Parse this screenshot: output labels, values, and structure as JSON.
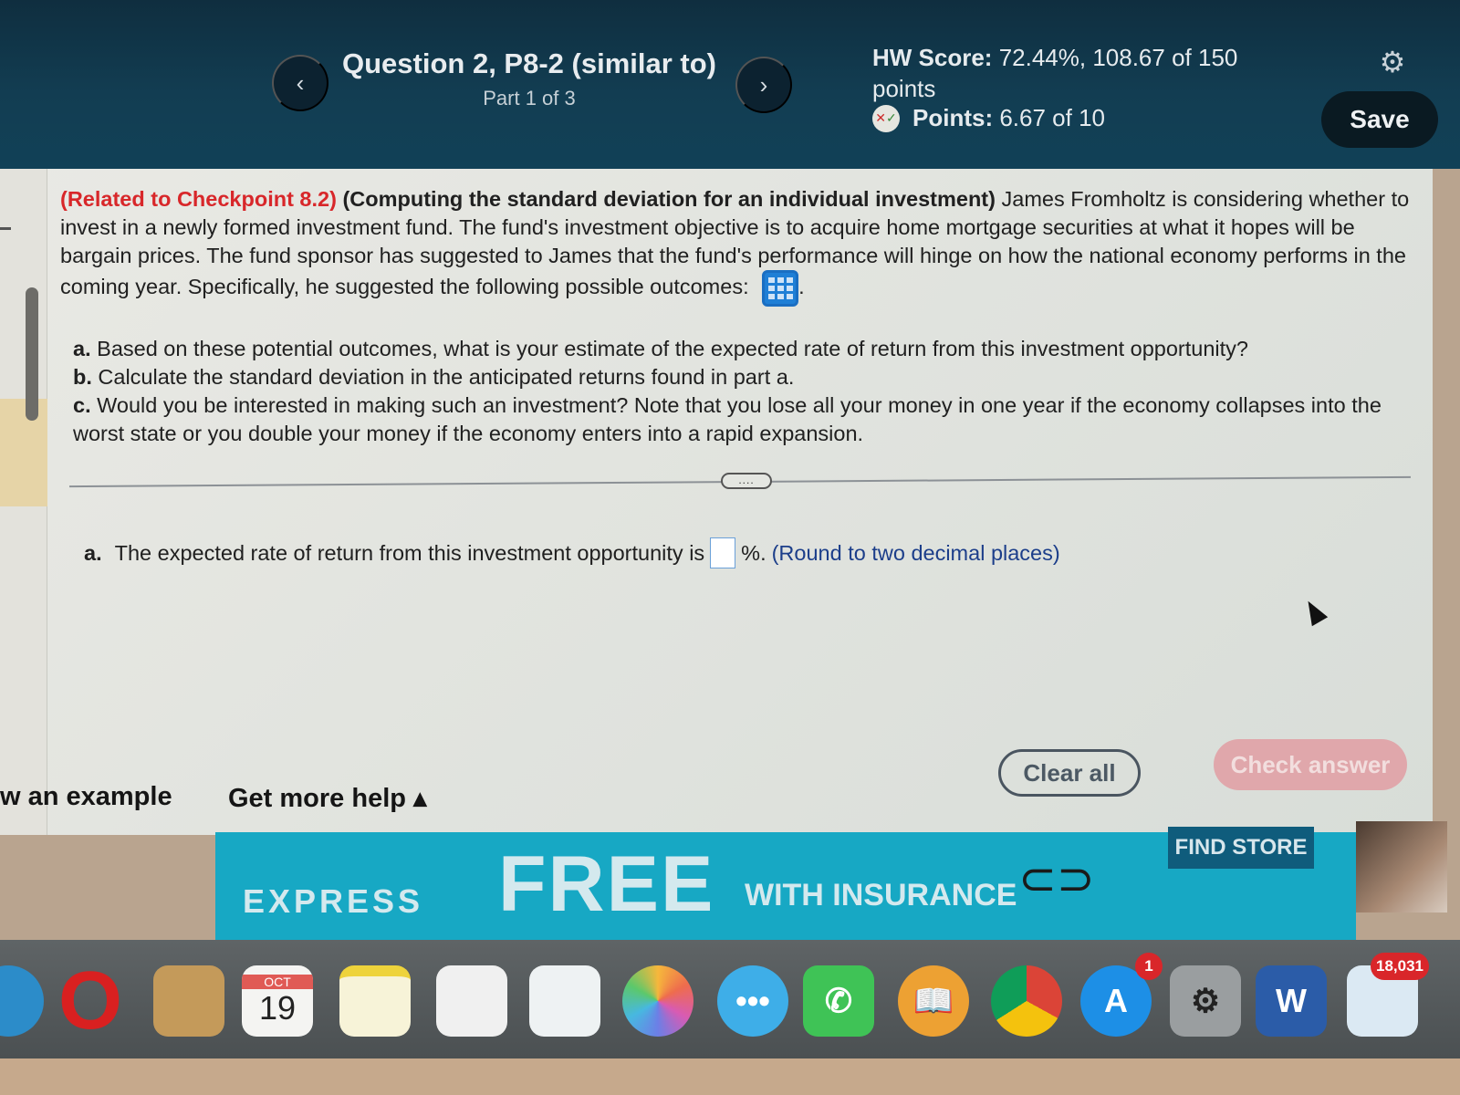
{
  "header": {
    "question_title": "Question 2, P8-2 (similar to)",
    "part": "Part 1 of 3",
    "prev_icon": "‹",
    "next_icon": "›",
    "hw_score_label": "HW Score:",
    "hw_score_value": "72.44%, 108.67 of 150 points",
    "points_label": "Points:",
    "points_value": "6.67 of 10",
    "gear_icon": "⚙",
    "save_label": "Save"
  },
  "problem": {
    "related": "(Related to Checkpoint 8.2)",
    "topic": "(Computing the standard deviation for an individual investment)",
    "body": "James Fromholtz is considering whether to invest in a newly formed investment fund.  The fund's investment objective is to acquire home mortgage securities at what it hopes will be bargain prices.  The fund sponsor has suggested to James that the fund's performance will hinge on how the national economy performs in the coming year.  Specifically, he suggested the following possible outcomes:",
    "after_icon": ".",
    "parts": [
      {
        "label": "a.",
        "text": "Based on these potential outcomes, what is your estimate of the expected rate of return from this investment opportunity?"
      },
      {
        "label": "b.",
        "text": "Calculate the standard deviation in the anticipated returns found in part a."
      },
      {
        "label": "c.",
        "text": "Would you be interested in making such an investment?  Note that you lose all your money in one year if the economy collapses into the worst state or you double your money if the economy enters into a rapid expansion."
      }
    ]
  },
  "expand_label": "....",
  "answer": {
    "label": "a.",
    "prefix": "The expected rate of return from this investment opportunity is",
    "value": "",
    "suffix": "%.",
    "hint": "(Round to two decimal places)"
  },
  "footer": {
    "example_link": "w an example",
    "help_link": "Get more help ▴",
    "clear_all": "Clear all",
    "check_answer": "Check answer"
  },
  "ad": {
    "brand": "EXPRESS",
    "headline": "FREE",
    "subline": "WITH INSURANCE",
    "cta": "FIND STORE"
  },
  "dock": {
    "calendar_month": "OCT",
    "calendar_day": "19",
    "app_store_badge": "1",
    "mail_badge": "18,031",
    "word_letter": "W"
  }
}
